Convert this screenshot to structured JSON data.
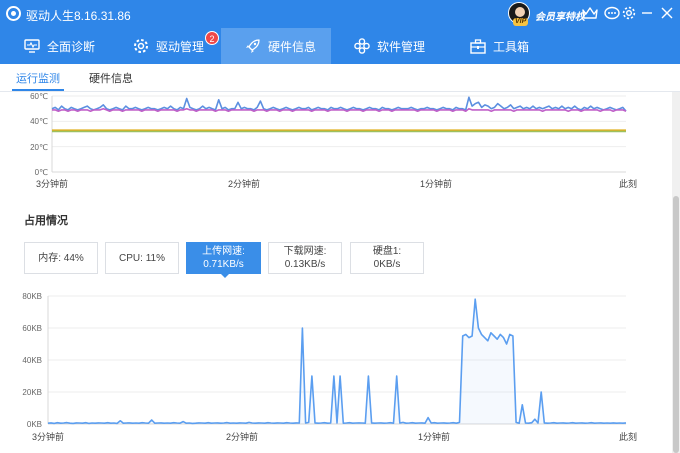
{
  "app": {
    "title": "驱动人生8.16.31.86"
  },
  "titlebar": {
    "member_text": "会员享特权",
    "vip_badge": "VIP"
  },
  "nav": {
    "items": [
      {
        "label": "全面诊断",
        "icon": "monitor-icon"
      },
      {
        "label": "驱动管理",
        "icon": "gear-icon",
        "badge": "2"
      },
      {
        "label": "硬件信息",
        "icon": "rocket-icon",
        "active": true
      },
      {
        "label": "软件管理",
        "icon": "apps-icon"
      },
      {
        "label": "工具箱",
        "icon": "toolbox-icon"
      }
    ]
  },
  "subtabs": {
    "monitor": "运行监测",
    "hardware": "硬件信息"
  },
  "temperature_chart": {
    "y_ticks": [
      "60℃",
      "40℃",
      "20℃",
      "0℃"
    ],
    "x_ticks": [
      "3分钟前",
      "2分钟前",
      "1分钟前",
      "此刻"
    ]
  },
  "usage": {
    "title": "占用情况",
    "stats": [
      {
        "label": "内存:",
        "value": "44%"
      },
      {
        "label": "CPU:",
        "value": "11%"
      },
      {
        "label": "上传网速:",
        "value": "0.71KB/s",
        "active": true
      },
      {
        "label": "下载网速:",
        "value": "0.13KB/s"
      },
      {
        "label": "硬盘1:",
        "value": "0KB/s"
      }
    ]
  },
  "network_chart": {
    "y_ticks": [
      "80KB",
      "60KB",
      "40KB",
      "20KB",
      "0KB"
    ],
    "x_ticks": [
      "3分钟前",
      "2分钟前",
      "1分钟前",
      "此刻"
    ]
  },
  "chart_data": [
    {
      "type": "line",
      "ylim": [
        0,
        60
      ],
      "xlim": [
        0,
        180
      ],
      "x_ticks": [
        "3分钟前",
        "2分钟前",
        "1分钟前",
        "此刻"
      ],
      "y_ticks": [
        "0℃",
        "20℃",
        "40℃",
        "60℃"
      ],
      "series": [
        {
          "color": "#5b8fe0",
          "values": [
            50,
            51,
            49,
            52,
            50,
            49,
            51,
            50,
            49,
            50,
            51,
            52,
            50,
            49,
            50,
            51,
            53,
            50,
            49,
            50,
            51,
            50,
            49,
            52,
            50,
            50,
            51,
            50,
            49,
            50,
            51,
            50,
            50,
            49,
            50,
            51,
            50,
            52,
            50,
            49,
            51,
            50,
            58,
            51,
            50,
            49,
            50,
            52,
            50,
            51,
            50,
            49,
            57,
            50,
            51,
            49,
            50,
            50,
            55,
            50,
            51,
            50,
            50,
            49,
            51,
            56,
            50,
            49,
            50,
            51,
            50,
            49,
            50,
            51,
            50,
            49,
            50,
            51,
            50,
            50,
            51,
            49,
            50,
            51,
            50,
            50,
            49,
            51,
            50,
            50,
            51,
            50,
            49,
            50,
            51,
            50,
            50,
            49,
            50,
            51,
            50,
            50,
            49,
            51,
            50,
            50,
            49,
            50,
            51,
            50,
            50,
            50,
            51,
            50,
            49,
            50,
            50,
            51,
            50,
            50,
            49,
            50,
            51,
            50,
            50,
            49,
            51,
            50,
            50,
            49,
            59,
            52,
            54,
            55,
            51,
            53,
            52,
            50,
            51,
            54,
            52,
            50,
            51,
            53,
            50,
            51,
            52,
            50,
            51,
            50,
            52,
            50,
            51,
            50,
            51,
            52,
            50,
            51,
            50,
            52,
            50,
            51,
            50,
            52,
            50,
            49,
            51,
            50,
            52,
            50,
            51,
            50,
            49,
            50,
            51,
            50,
            49,
            50,
            51,
            48
          ]
        },
        {
          "color": "#c060c8",
          "values": [
            49,
            49,
            48,
            49,
            49,
            48,
            49,
            49,
            48,
            49,
            49,
            49,
            48,
            49,
            49,
            49,
            50,
            49,
            48,
            49,
            49,
            49,
            48,
            49,
            49,
            49,
            49,
            49,
            48,
            49,
            49,
            49,
            49,
            48,
            49,
            49,
            49,
            49,
            49,
            48,
            49,
            49,
            50,
            49,
            49,
            48,
            49,
            49,
            49,
            49,
            49,
            48,
            49,
            49,
            49,
            48,
            49,
            49,
            49,
            49,
            49,
            49,
            49,
            48,
            49,
            49,
            49,
            48,
            49,
            49,
            49,
            48,
            49,
            49,
            49,
            48,
            49,
            49,
            49,
            49,
            49,
            48,
            49,
            49,
            49,
            49,
            48,
            49,
            49,
            49,
            49,
            49,
            48,
            49,
            49,
            49,
            49,
            48,
            49,
            49,
            49,
            49,
            48,
            49,
            49,
            49,
            48,
            49,
            49,
            49,
            49,
            49,
            49,
            49,
            48,
            49,
            49,
            49,
            49,
            49,
            48,
            49,
            49,
            49,
            49,
            48,
            49,
            49,
            49,
            48,
            50,
            49,
            49,
            49,
            49,
            49,
            49,
            48,
            49,
            49,
            49,
            49,
            49,
            49,
            48,
            49,
            49,
            49,
            49,
            49,
            49,
            49,
            49,
            48,
            49,
            49,
            49,
            49,
            49,
            49,
            49,
            48,
            49,
            49,
            49,
            48,
            49,
            49,
            49,
            49,
            49,
            48,
            49,
            49,
            49,
            48,
            49,
            49,
            49,
            48
          ]
        },
        {
          "color": "#e0b020",
          "values": [
            33,
            33,
            33,
            33,
            33,
            33,
            33,
            33,
            33,
            33,
            33,
            33,
            33,
            33,
            33,
            33,
            33,
            33,
            33,
            33,
            33,
            33,
            33,
            33,
            33,
            33,
            33,
            33,
            33,
            33,
            33,
            33,
            33,
            33,
            33,
            33,
            33,
            33,
            33,
            33,
            33,
            33,
            33,
            33,
            33,
            33,
            33,
            33,
            33,
            33,
            33,
            33,
            33,
            33,
            33,
            33,
            33,
            33,
            33,
            33,
            33,
            33,
            33,
            33,
            33,
            33,
            33,
            33,
            33,
            33,
            33,
            33,
            33,
            33,
            33,
            33,
            33,
            33,
            33,
            33,
            33,
            33,
            33,
            33,
            33,
            33,
            33,
            33,
            33,
            33,
            33,
            33,
            33,
            33,
            33,
            33,
            33,
            33,
            33,
            33,
            33,
            33,
            33,
            33,
            33,
            33,
            33,
            33,
            33,
            33,
            33,
            33,
            33,
            33,
            33,
            33,
            33,
            33,
            33,
            33,
            33,
            33,
            33,
            33,
            33,
            33,
            33,
            33,
            33,
            33,
            33,
            33,
            33,
            33,
            33,
            33,
            33,
            33,
            33,
            33,
            33,
            33,
            33,
            33,
            33,
            33,
            33,
            33,
            33,
            33,
            33,
            33,
            33,
            33,
            33,
            33,
            33,
            33,
            33,
            33,
            33,
            33,
            33,
            33,
            33,
            33,
            33,
            33,
            33,
            33,
            33,
            33,
            33,
            33,
            33,
            33,
            33,
            33,
            33
          ]
        },
        {
          "color": "#9cc060",
          "values": [
            32,
            32,
            32,
            32,
            32,
            32,
            32,
            32,
            32,
            32,
            32,
            32,
            32,
            32,
            32,
            32,
            32,
            32,
            32,
            32,
            32,
            32,
            32,
            32,
            32,
            32,
            32,
            32,
            32,
            32,
            32,
            32,
            32,
            32,
            32,
            32,
            32,
            32,
            32,
            32,
            32,
            32,
            32,
            32,
            32,
            32,
            32,
            32,
            32,
            32,
            32,
            32,
            32,
            32,
            32,
            32,
            32,
            32,
            32,
            32,
            32,
            32,
            32,
            32,
            32,
            32,
            32,
            32,
            32,
            32,
            32,
            32,
            32,
            32,
            32,
            32,
            32,
            32,
            32,
            32,
            32,
            32,
            32,
            32,
            32,
            32,
            32,
            32,
            32,
            32,
            32,
            32,
            32,
            32,
            32,
            32,
            32,
            32,
            32,
            32,
            32,
            32,
            32,
            32,
            32,
            32,
            32,
            32,
            32,
            32,
            32,
            32,
            32,
            32,
            32,
            32,
            32,
            32,
            32,
            32,
            32,
            32,
            32,
            32,
            32,
            32,
            32,
            32,
            32,
            32,
            32,
            32,
            32,
            32,
            32,
            32,
            32,
            32,
            32,
            32,
            32,
            32,
            32,
            32,
            32,
            32,
            32,
            32,
            32,
            32,
            32,
            32,
            32,
            32,
            32,
            32,
            32,
            32,
            32,
            32,
            32,
            32,
            32,
            32,
            32,
            32,
            32,
            32,
            32,
            32,
            32,
            32,
            32,
            32,
            32,
            32,
            32,
            32,
            32
          ]
        }
      ]
    },
    {
      "type": "area",
      "ylim": [
        0,
        80
      ],
      "xlim": [
        0,
        180
      ],
      "x_ticks": [
        "3分钟前",
        "2分钟前",
        "1分钟前",
        "此刻"
      ],
      "y_ticks": [
        "0KB",
        "20KB",
        "40KB",
        "60KB",
        "80KB"
      ],
      "series": [
        {
          "color": "#5b9ef0",
          "values": [
            0.5,
            0.7,
            0.4,
            0.8,
            0.5,
            0.6,
            0.9,
            0.5,
            0.4,
            0.7,
            0.6,
            0.5,
            0.8,
            0.4,
            0.6,
            0.5,
            0.7,
            0.6,
            0.5,
            0.8,
            0.5,
            0.6,
            0.4,
            2,
            0.5,
            0.6,
            0.7,
            0.5,
            0.6,
            0.5,
            0.8,
            0.6,
            0.5,
            2.5,
            0.5,
            0.6,
            0.7,
            0.5,
            0.6,
            0.5,
            0.8,
            0.6,
            0.5,
            1.5,
            0.5,
            0.6,
            0.4,
            0.5,
            0.7,
            0.6,
            0.5,
            0.8,
            0.5,
            0.6,
            0.7,
            0.5,
            0.6,
            0.9,
            0.5,
            0.6,
            0.5,
            0.7,
            0.6,
            0.5,
            1,
            0.6,
            0.5,
            0.7,
            0.6,
            0.5,
            0.8,
            0.6,
            0.5,
            0.7,
            0.6,
            0.5,
            0.8,
            0.6,
            0.5,
            0.7,
            0.6,
            60,
            0.6,
            1,
            30,
            0.7,
            0.5,
            0.6,
            0.8,
            0.5,
            0.6,
            30,
            0.7,
            30,
            0.5,
            0.6,
            0.8,
            0.5,
            0.6,
            0.7,
            0.6,
            0.5,
            30,
            0.7,
            0.5,
            0.6,
            0.7,
            0.5,
            0.6,
            0.8,
            0.5,
            30,
            0.6,
            1,
            0.5,
            0.6,
            0.8,
            0.5,
            0.6,
            0.7,
            0.5,
            4,
            0.6,
            0.8,
            0.5,
            0.6,
            0.7,
            0.5,
            0.6,
            0.8,
            0.5,
            1,
            55,
            56,
            54,
            55,
            78,
            60,
            56,
            54,
            52,
            57,
            55,
            53,
            56,
            54,
            50,
            56,
            55,
            1,
            0.5,
            12,
            0.6,
            0.5,
            0.8,
            3,
            0.6,
            20,
            0.7,
            0.5,
            0.6,
            0.8,
            0.5,
            0.6,
            0.7,
            0.5,
            0.6,
            0.8,
            0.5,
            0.6,
            0.7,
            0.5,
            0.6,
            0.8,
            0.5,
            0.6,
            0.7,
            0.5,
            0.6,
            0.5,
            0.7,
            0.5,
            0.6,
            0.5,
            0.7
          ]
        }
      ]
    }
  ]
}
